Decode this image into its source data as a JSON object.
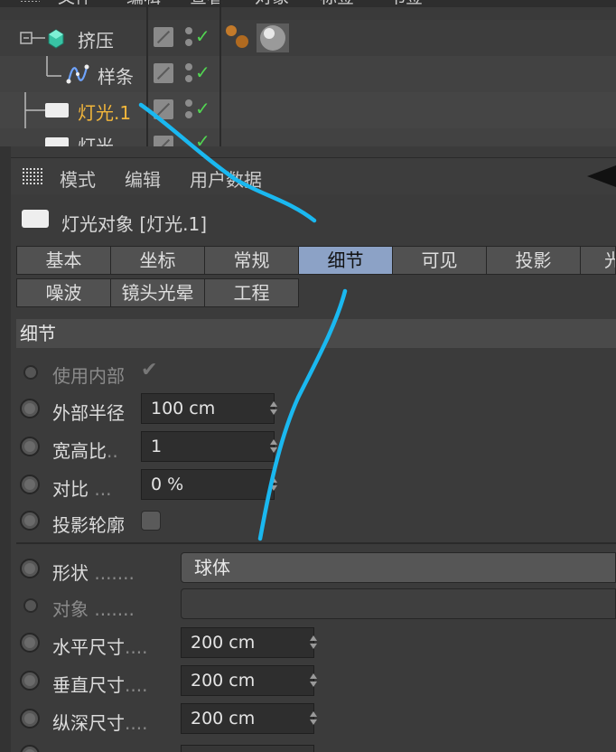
{
  "top_menu": {
    "items": [
      "文件",
      "编辑",
      "查看",
      "对象",
      "标签",
      "书签"
    ]
  },
  "object_tree": [
    {
      "label": "挤压",
      "type": "extrude"
    },
    {
      "label": "样条",
      "type": "spline"
    },
    {
      "label": "灯光.1",
      "type": "light",
      "selected": true
    },
    {
      "label": "灯光",
      "type": "light"
    }
  ],
  "attr_menu": {
    "items": [
      "模式",
      "编辑",
      "用户数据"
    ]
  },
  "object_title": "灯光对象 [灯光.1]",
  "tabs": {
    "row1": [
      "基本",
      "坐标",
      "常规",
      "细节",
      "可见",
      "投影",
      "光"
    ],
    "row2": [
      "噪波",
      "镜头光晕",
      "工程"
    ],
    "active": "细节"
  },
  "section": {
    "title": "细节"
  },
  "params": {
    "use_inner": {
      "label": "使用内部",
      "check": "✔"
    },
    "outer_radius": {
      "label": "外部半径",
      "value": "100 cm"
    },
    "aspect_ratio": {
      "label": "宽高比",
      "dots": "..",
      "value": "1"
    },
    "contrast": {
      "label": "对比",
      "dots": "...",
      "value": "0 %"
    },
    "shadow_caster": {
      "label": "投影轮廓"
    },
    "shape": {
      "label": "形状",
      "dots": ".......",
      "value": "球体"
    },
    "object": {
      "label": "对象",
      "dots": "......."
    },
    "size_h": {
      "label": "水平尺寸",
      "dots": "....",
      "value": "200 cm"
    },
    "size_v": {
      "label": "垂直尺寸",
      "dots": "....",
      "value": "200 cm"
    },
    "size_d": {
      "label": "纵深尺寸",
      "dots": "....",
      "value": "200 cm"
    }
  },
  "colors": {
    "accent_tab": "#8ca2c6",
    "selected_name": "#f2b63b",
    "check_green": "#52d552",
    "annotation": "#1ab8f0"
  }
}
